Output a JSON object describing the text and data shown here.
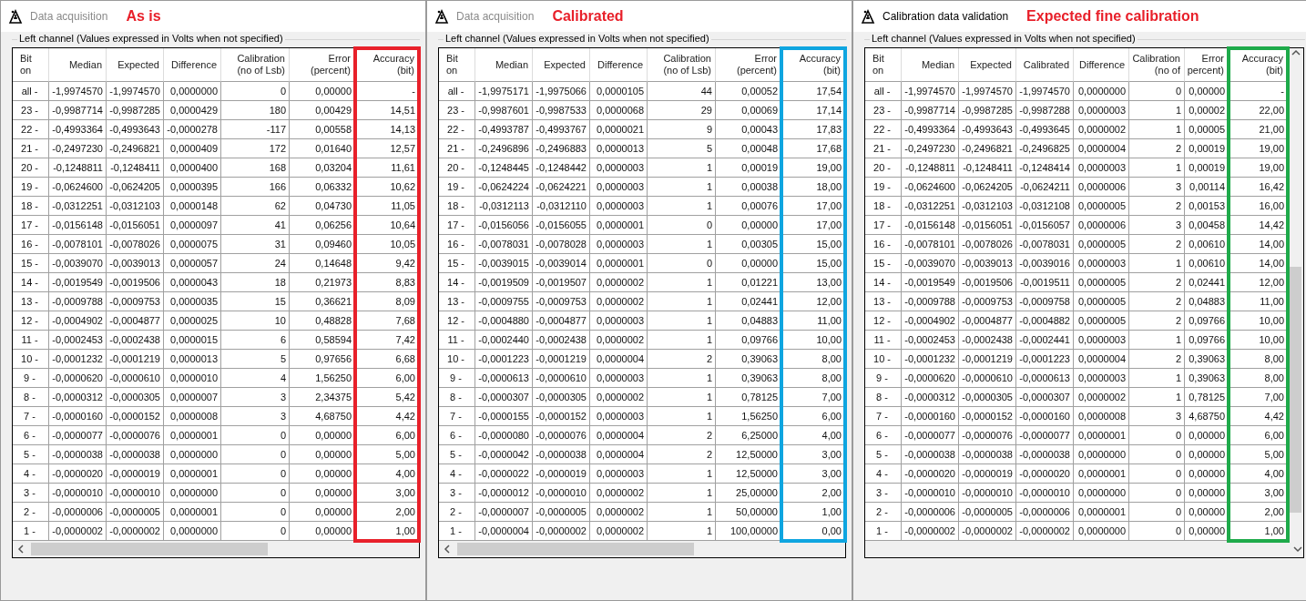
{
  "windows": [
    {
      "title": "Data acquisition",
      "active": false,
      "annotation": "As is",
      "color": "#e8202a",
      "group_label": "Left channel (Values expressed in Volts when not specified)",
      "kind": "horizontal",
      "columns": [
        {
          "lines": [
            "Bit",
            "on"
          ]
        },
        {
          "lines": [
            "Median"
          ]
        },
        {
          "lines": [
            "Expected"
          ]
        },
        {
          "lines": [
            "Difference"
          ]
        },
        {
          "lines": [
            "Calibration",
            "(no of Lsb)"
          ]
        },
        {
          "lines": [
            "Error",
            "(percent)"
          ]
        },
        {
          "lines": [
            "Accuracy",
            "(bit)"
          ]
        }
      ],
      "rows": [
        [
          "all -",
          "-1,9974570",
          "-1,9974570",
          "0,0000000",
          "0",
          "0,00000",
          "-"
        ],
        [
          "23 -",
          "-0,9987714",
          "-0,9987285",
          "0,0000429",
          "180",
          "0,00429",
          "14,51"
        ],
        [
          "22 -",
          "-0,4993364",
          "-0,4993643",
          "-0,0000278",
          "-117",
          "0,00558",
          "14,13"
        ],
        [
          "21 -",
          "-0,2497230",
          "-0,2496821",
          "0,0000409",
          "172",
          "0,01640",
          "12,57"
        ],
        [
          "20 -",
          "-0,1248811",
          "-0,1248411",
          "0,0000400",
          "168",
          "0,03204",
          "11,61"
        ],
        [
          "19 -",
          "-0,0624600",
          "-0,0624205",
          "0,0000395",
          "166",
          "0,06332",
          "10,62"
        ],
        [
          "18 -",
          "-0,0312251",
          "-0,0312103",
          "0,0000148",
          "62",
          "0,04730",
          "11,05"
        ],
        [
          "17 -",
          "-0,0156148",
          "-0,0156051",
          "0,0000097",
          "41",
          "0,06256",
          "10,64"
        ],
        [
          "16 -",
          "-0,0078101",
          "-0,0078026",
          "0,0000075",
          "31",
          "0,09460",
          "10,05"
        ],
        [
          "15 -",
          "-0,0039070",
          "-0,0039013",
          "0,0000057",
          "24",
          "0,14648",
          "9,42"
        ],
        [
          "14 -",
          "-0,0019549",
          "-0,0019506",
          "0,0000043",
          "18",
          "0,21973",
          "8,83"
        ],
        [
          "13 -",
          "-0,0009788",
          "-0,0009753",
          "0,0000035",
          "15",
          "0,36621",
          "8,09"
        ],
        [
          "12 -",
          "-0,0004902",
          "-0,0004877",
          "0,0000025",
          "10",
          "0,48828",
          "7,68"
        ],
        [
          "11 -",
          "-0,0002453",
          "-0,0002438",
          "0,0000015",
          "6",
          "0,58594",
          "7,42"
        ],
        [
          "10 -",
          "-0,0001232",
          "-0,0001219",
          "0,0000013",
          "5",
          "0,97656",
          "6,68"
        ],
        [
          "9 -",
          "-0,0000620",
          "-0,0000610",
          "0,0000010",
          "4",
          "1,56250",
          "6,00"
        ],
        [
          "8 -",
          "-0,0000312",
          "-0,0000305",
          "0,0000007",
          "3",
          "2,34375",
          "5,42"
        ],
        [
          "7 -",
          "-0,0000160",
          "-0,0000152",
          "0,0000008",
          "3",
          "4,68750",
          "4,42"
        ],
        [
          "6 -",
          "-0,0000077",
          "-0,0000076",
          "0,0000001",
          "0",
          "0,00000",
          "6,00"
        ],
        [
          "5 -",
          "-0,0000038",
          "-0,0000038",
          "0,0000000",
          "0",
          "0,00000",
          "5,00"
        ],
        [
          "4 -",
          "-0,0000020",
          "-0,0000019",
          "0,0000001",
          "0",
          "0,00000",
          "4,00"
        ],
        [
          "3 -",
          "-0,0000010",
          "-0,0000010",
          "0,0000000",
          "0",
          "0,00000",
          "3,00"
        ],
        [
          "2 -",
          "-0,0000006",
          "-0,0000005",
          "0,0000001",
          "0",
          "0,00000",
          "2,00"
        ],
        [
          "1 -",
          "-0,0000002",
          "-0,0000002",
          "0,0000000",
          "0",
          "0,00000",
          "1,00"
        ]
      ]
    },
    {
      "title": "Data acquisition",
      "active": false,
      "annotation": "Calibrated",
      "color": "#0ea5e0",
      "group_label": "Left channel (Values expressed in Volts when not specified)",
      "kind": "horizontal",
      "columns": [
        {
          "lines": [
            "Bit",
            "on"
          ]
        },
        {
          "lines": [
            "Median"
          ]
        },
        {
          "lines": [
            "Expected"
          ]
        },
        {
          "lines": [
            "Difference"
          ]
        },
        {
          "lines": [
            "Calibration",
            "(no of Lsb)"
          ]
        },
        {
          "lines": [
            "Error",
            "(percent)"
          ]
        },
        {
          "lines": [
            "Accuracy",
            "(bit)"
          ]
        }
      ],
      "rows": [
        [
          "all -",
          "-1,9975171",
          "-1,9975066",
          "0,0000105",
          "44",
          "0,00052",
          "17,54"
        ],
        [
          "23 -",
          "-0,9987601",
          "-0,9987533",
          "0,0000068",
          "29",
          "0,00069",
          "17,14"
        ],
        [
          "22 -",
          "-0,4993787",
          "-0,4993767",
          "0,0000021",
          "9",
          "0,00043",
          "17,83"
        ],
        [
          "21 -",
          "-0,2496896",
          "-0,2496883",
          "0,0000013",
          "5",
          "0,00048",
          "17,68"
        ],
        [
          "20 -",
          "-0,1248445",
          "-0,1248442",
          "0,0000003",
          "1",
          "0,00019",
          "19,00"
        ],
        [
          "19 -",
          "-0,0624224",
          "-0,0624221",
          "0,0000003",
          "1",
          "0,00038",
          "18,00"
        ],
        [
          "18 -",
          "-0,0312113",
          "-0,0312110",
          "0,0000003",
          "1",
          "0,00076",
          "17,00"
        ],
        [
          "17 -",
          "-0,0156056",
          "-0,0156055",
          "0,0000001",
          "0",
          "0,00000",
          "17,00"
        ],
        [
          "16 -",
          "-0,0078031",
          "-0,0078028",
          "0,0000003",
          "1",
          "0,00305",
          "15,00"
        ],
        [
          "15 -",
          "-0,0039015",
          "-0,0039014",
          "0,0000001",
          "0",
          "0,00000",
          "15,00"
        ],
        [
          "14 -",
          "-0,0019509",
          "-0,0019507",
          "0,0000002",
          "1",
          "0,01221",
          "13,00"
        ],
        [
          "13 -",
          "-0,0009755",
          "-0,0009753",
          "0,0000002",
          "1",
          "0,02441",
          "12,00"
        ],
        [
          "12 -",
          "-0,0004880",
          "-0,0004877",
          "0,0000003",
          "1",
          "0,04883",
          "11,00"
        ],
        [
          "11 -",
          "-0,0002440",
          "-0,0002438",
          "0,0000002",
          "1",
          "0,09766",
          "10,00"
        ],
        [
          "10 -",
          "-0,0001223",
          "-0,0001219",
          "0,0000004",
          "2",
          "0,39063",
          "8,00"
        ],
        [
          "9 -",
          "-0,0000613",
          "-0,0000610",
          "0,0000003",
          "1",
          "0,39063",
          "8,00"
        ],
        [
          "8 -",
          "-0,0000307",
          "-0,0000305",
          "0,0000002",
          "1",
          "0,78125",
          "7,00"
        ],
        [
          "7 -",
          "-0,0000155",
          "-0,0000152",
          "0,0000003",
          "1",
          "1,56250",
          "6,00"
        ],
        [
          "6 -",
          "-0,0000080",
          "-0,0000076",
          "0,0000004",
          "2",
          "6,25000",
          "4,00"
        ],
        [
          "5 -",
          "-0,0000042",
          "-0,0000038",
          "0,0000004",
          "2",
          "12,50000",
          "3,00"
        ],
        [
          "4 -",
          "-0,0000022",
          "-0,0000019",
          "0,0000003",
          "1",
          "12,50000",
          "3,00"
        ],
        [
          "3 -",
          "-0,0000012",
          "-0,0000010",
          "0,0000002",
          "1",
          "25,00000",
          "2,00"
        ],
        [
          "2 -",
          "-0,0000007",
          "-0,0000005",
          "0,0000002",
          "1",
          "50,00000",
          "1,00"
        ],
        [
          "1 -",
          "-0,0000004",
          "-0,0000002",
          "0,0000002",
          "1",
          "100,00000",
          "0,00"
        ]
      ]
    },
    {
      "title": "Calibration data validation",
      "active": true,
      "annotation": "Expected fine calibration",
      "color": "#1eaa4a",
      "group_label": "Left channel (Values expressed in Volts when not specified)",
      "kind": "vertical",
      "columns": [
        {
          "lines": [
            "Bit",
            "on"
          ]
        },
        {
          "lines": [
            "Median"
          ]
        },
        {
          "lines": [
            "Expected"
          ]
        },
        {
          "lines": [
            "Calibrated"
          ]
        },
        {
          "lines": [
            "Difference"
          ]
        },
        {
          "lines": [
            "Calibration",
            "(no of"
          ]
        },
        {
          "lines": [
            "Error",
            "percent)"
          ]
        },
        {
          "lines": [
            "Accuracy",
            "(bit)"
          ]
        }
      ],
      "rows": [
        [
          "all -",
          "-1,9974570",
          "-1,9974570",
          "-1,9974570",
          "0,0000000",
          "0",
          "0,00000",
          "-"
        ],
        [
          "23 -",
          "-0,9987714",
          "-0,9987285",
          "-0,9987288",
          "0,0000003",
          "1",
          "0,00002",
          "22,00"
        ],
        [
          "22 -",
          "-0,4993364",
          "-0,4993643",
          "-0,4993645",
          "0,0000002",
          "1",
          "0,00005",
          "21,00"
        ],
        [
          "21 -",
          "-0,2497230",
          "-0,2496821",
          "-0,2496825",
          "0,0000004",
          "2",
          "0,00019",
          "19,00"
        ],
        [
          "20 -",
          "-0,1248811",
          "-0,1248411",
          "-0,1248414",
          "0,0000003",
          "1",
          "0,00019",
          "19,00"
        ],
        [
          "19 -",
          "-0,0624600",
          "-0,0624205",
          "-0,0624211",
          "0,0000006",
          "3",
          "0,00114",
          "16,42"
        ],
        [
          "18 -",
          "-0,0312251",
          "-0,0312103",
          "-0,0312108",
          "0,0000005",
          "2",
          "0,00153",
          "16,00"
        ],
        [
          "17 -",
          "-0,0156148",
          "-0,0156051",
          "-0,0156057",
          "0,0000006",
          "3",
          "0,00458",
          "14,42"
        ],
        [
          "16 -",
          "-0,0078101",
          "-0,0078026",
          "-0,0078031",
          "0,0000005",
          "2",
          "0,00610",
          "14,00"
        ],
        [
          "15 -",
          "-0,0039070",
          "-0,0039013",
          "-0,0039016",
          "0,0000003",
          "1",
          "0,00610",
          "14,00"
        ],
        [
          "14 -",
          "-0,0019549",
          "-0,0019506",
          "-0,0019511",
          "0,0000005",
          "2",
          "0,02441",
          "12,00"
        ],
        [
          "13 -",
          "-0,0009788",
          "-0,0009753",
          "-0,0009758",
          "0,0000005",
          "2",
          "0,04883",
          "11,00"
        ],
        [
          "12 -",
          "-0,0004902",
          "-0,0004877",
          "-0,0004882",
          "0,0000005",
          "2",
          "0,09766",
          "10,00"
        ],
        [
          "11 -",
          "-0,0002453",
          "-0,0002438",
          "-0,0002441",
          "0,0000003",
          "1",
          "0,09766",
          "10,00"
        ],
        [
          "10 -",
          "-0,0001232",
          "-0,0001219",
          "-0,0001223",
          "0,0000004",
          "2",
          "0,39063",
          "8,00"
        ],
        [
          "9 -",
          "-0,0000620",
          "-0,0000610",
          "-0,0000613",
          "0,0000003",
          "1",
          "0,39063",
          "8,00"
        ],
        [
          "8 -",
          "-0,0000312",
          "-0,0000305",
          "-0,0000307",
          "0,0000002",
          "1",
          "0,78125",
          "7,00"
        ],
        [
          "7 -",
          "-0,0000160",
          "-0,0000152",
          "-0,0000160",
          "0,0000008",
          "3",
          "4,68750",
          "4,42"
        ],
        [
          "6 -",
          "-0,0000077",
          "-0,0000076",
          "-0,0000077",
          "0,0000001",
          "0",
          "0,00000",
          "6,00"
        ],
        [
          "5 -",
          "-0,0000038",
          "-0,0000038",
          "-0,0000038",
          "0,0000000",
          "0",
          "0,00000",
          "5,00"
        ],
        [
          "4 -",
          "-0,0000020",
          "-0,0000019",
          "-0,0000020",
          "0,0000001",
          "0",
          "0,00000",
          "4,00"
        ],
        [
          "3 -",
          "-0,0000010",
          "-0,0000010",
          "-0,0000010",
          "0,0000000",
          "0",
          "0,00000",
          "3,00"
        ],
        [
          "2 -",
          "-0,0000006",
          "-0,0000005",
          "-0,0000006",
          "0,0000001",
          "0",
          "0,00000",
          "2,00"
        ],
        [
          "1 -",
          "-0,0000002",
          "-0,0000002",
          "-0,0000002",
          "0,0000000",
          "0",
          "0,00000",
          "1,00"
        ]
      ]
    }
  ]
}
